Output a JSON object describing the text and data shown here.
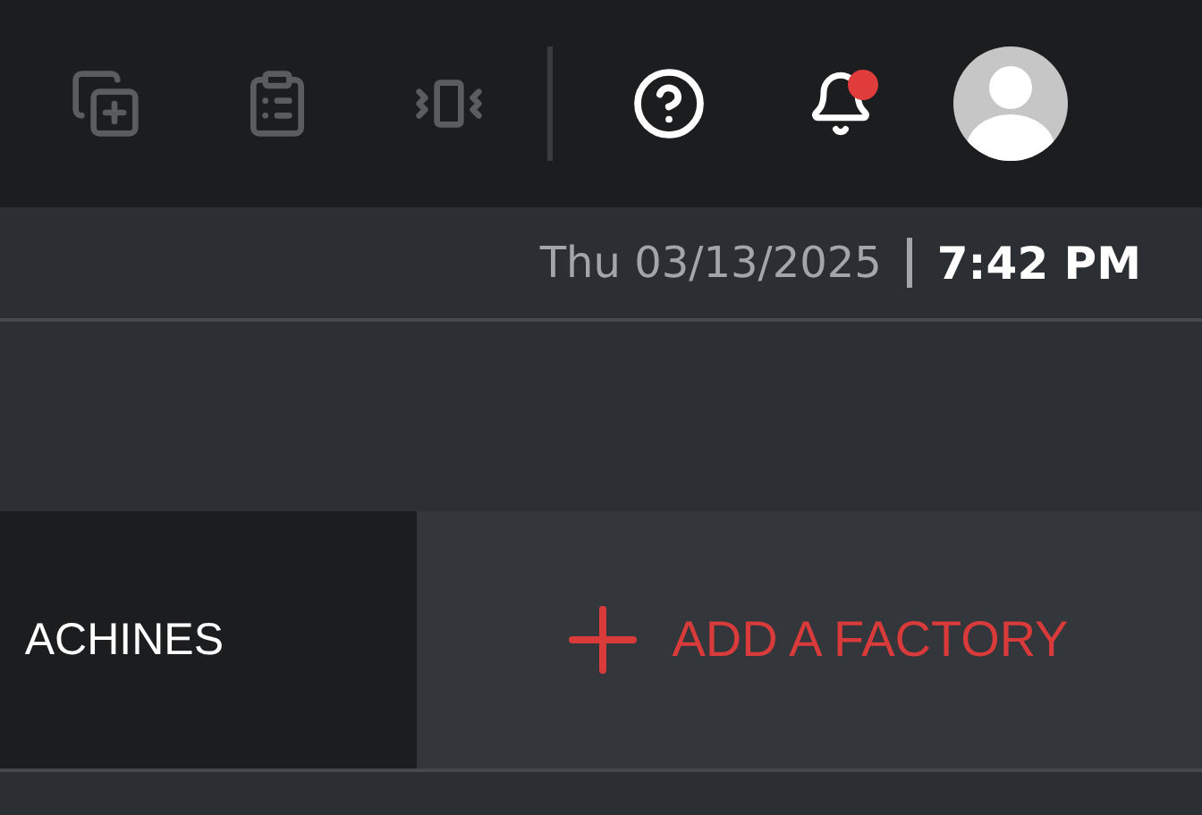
{
  "toolbar": {
    "actions": [
      {
        "kind": "add-copy",
        "disabled": true
      },
      {
        "kind": "clipboard",
        "disabled": true
      },
      {
        "kind": "vibrate",
        "disabled": true
      }
    ],
    "notifications": {
      "unread": true
    }
  },
  "datetime": {
    "date": "Thu 03/13/2025",
    "time": "7:42 PM"
  },
  "tabs": [
    {
      "label": "ACHINES",
      "kind": "tab"
    },
    {
      "label": "ADD A FACTORY",
      "kind": "add"
    }
  ]
}
